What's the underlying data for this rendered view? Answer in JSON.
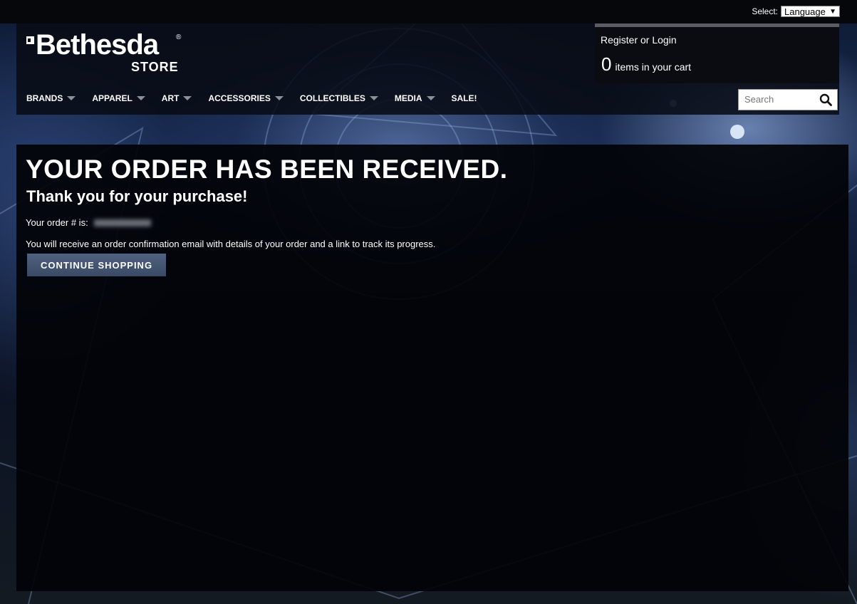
{
  "topbar": {
    "language_label": "Select:",
    "language_value": "Language",
    "language_arrow": "▼"
  },
  "logo": {
    "name": "Bethesda",
    "reg": "®",
    "sub": "STORE"
  },
  "account": {
    "login_label": "Register or Login",
    "cart_count": "0",
    "cart_label": "items in your cart"
  },
  "nav": {
    "items": [
      {
        "label": "BRANDS",
        "has_dropdown": true
      },
      {
        "label": "APPAREL",
        "has_dropdown": true
      },
      {
        "label": "ART",
        "has_dropdown": true
      },
      {
        "label": "ACCESSORIES",
        "has_dropdown": true
      },
      {
        "label": "COLLECTIBLES",
        "has_dropdown": true
      },
      {
        "label": "MEDIA",
        "has_dropdown": true
      },
      {
        "label": "SALE!",
        "has_dropdown": false
      }
    ]
  },
  "search": {
    "placeholder": "Search",
    "icon": "search-icon"
  },
  "confirmation": {
    "title": "YOUR ORDER HAS BEEN RECEIVED.",
    "subtitle": "Thank you for your purchase!",
    "order_label": "Your order # is:",
    "email_message": "You will receive an order confirmation email with details of your order and a link to track its progress.",
    "continue_label": "CONTINUE SHOPPING"
  },
  "colors": {
    "button": "#44557a",
    "panel": "#020307",
    "caret": "#8d9096"
  }
}
